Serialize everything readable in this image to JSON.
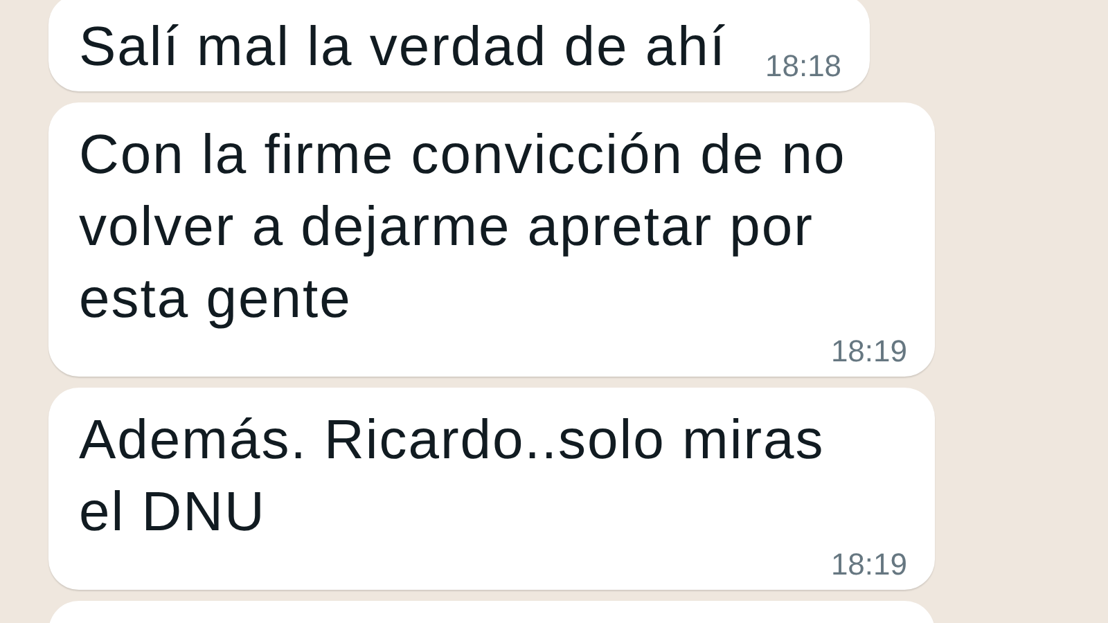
{
  "messages": [
    {
      "text": "Salí mal la verdad de ahí",
      "time": "18:18"
    },
    {
      "text": "Con la firme convicción de no volver a dejarme apretar por esta gente",
      "time": "18:19"
    },
    {
      "text": "Además. Ricardo..solo miras el DNU",
      "time": "18:19"
    }
  ],
  "next_bubble_visible": true
}
